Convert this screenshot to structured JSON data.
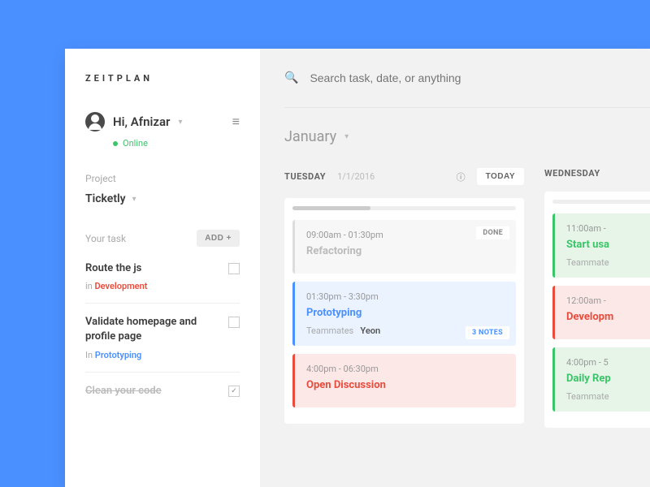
{
  "logo": "ZEITPLAN",
  "user": {
    "greeting": "Hi, Afnizar",
    "status": "Online"
  },
  "project": {
    "label": "Project",
    "name": "Ticketly"
  },
  "tasks": {
    "label": "Your task",
    "add": "ADD +",
    "items": [
      {
        "title": "Route the js",
        "prefix": "in ",
        "cat": "Development",
        "catClass": "cat-dev",
        "checked": false
      },
      {
        "title": "Validate homepage and profile page",
        "prefix": "In ",
        "cat": "Prototyping",
        "catClass": "cat-proto",
        "checked": false
      },
      {
        "title": "Clean your code",
        "prefix": "",
        "cat": "",
        "catClass": "",
        "checked": true
      }
    ]
  },
  "search": {
    "placeholder": "Search task, date, or anything"
  },
  "month": "January",
  "days": [
    {
      "name": "TUESDAY",
      "date": "1/1/2016",
      "today": "TODAY",
      "events": [
        {
          "time": "09:00am - 01:30pm",
          "title": "Refactoring",
          "cls": "done",
          "badge": "DONE",
          "team": ""
        },
        {
          "time": "01:30pm - 3:30pm",
          "title": "Prototyping",
          "cls": "blue",
          "badge": "3 NOTES",
          "teamLabel": "Teammates",
          "teamName": "Yeon"
        },
        {
          "time": "4:00pm - 06:30pm",
          "title": "Open Discussion",
          "cls": "red",
          "badge": "",
          "team": ""
        }
      ]
    },
    {
      "name": "WEDNESDAY",
      "date": "",
      "events": [
        {
          "time": "11:00am - ",
          "title": "Start usa",
          "cls": "green",
          "teamLabel": "Teammate"
        },
        {
          "time": "12:00am - ",
          "title": "Developm",
          "cls": "red"
        },
        {
          "time": "4:00pm - 5",
          "title": "Daily Rep",
          "cls": "green",
          "teamLabel": "Teammate"
        }
      ]
    }
  ]
}
